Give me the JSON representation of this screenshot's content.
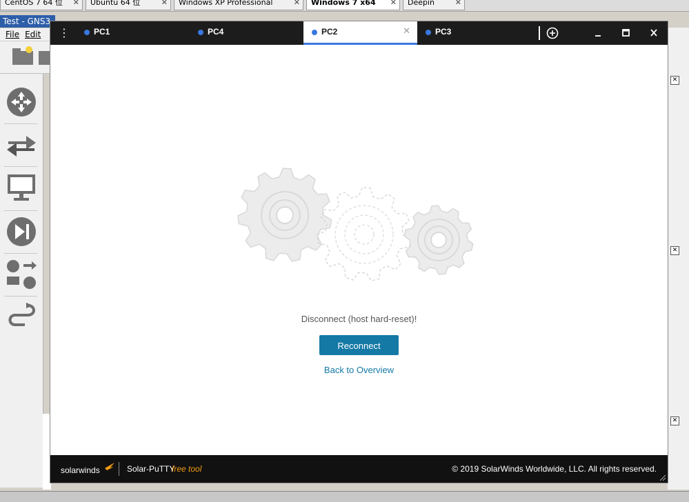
{
  "vm_tabs": [
    {
      "label": "CentOS 7 64 位",
      "active": false
    },
    {
      "label": "Ubuntu 64 位",
      "active": false
    },
    {
      "label": "Windows XP Professional",
      "active": false
    },
    {
      "label": "Windows 7 x64",
      "active": true
    },
    {
      "label": "Deepin",
      "active": false
    }
  ],
  "gns": {
    "title": "Test - GNS3",
    "menu": [
      "File",
      "Edit"
    ]
  },
  "putty": {
    "tabs": [
      {
        "label": "PC1",
        "active": false
      },
      {
        "label": "PC4",
        "active": false
      },
      {
        "label": "PC2",
        "active": true
      },
      {
        "label": "PC3",
        "active": false
      }
    ],
    "message": "Disconnect (host hard-reset)!",
    "reconnect_label": "Reconnect",
    "back_label": "Back to Overview",
    "footer": {
      "brand": "solarwinds",
      "product": "Solar-PuTTY",
      "free_tool": "free tool",
      "copyright": "© 2019 SolarWinds Worldwide, LLC. All rights reserved."
    }
  },
  "colors": {
    "accent": "#1479a5",
    "tab_dot": "#3a78e0",
    "tabbar_bg": "#1c1c1c",
    "footer_bg": "#111111",
    "free_tool": "#f39c12"
  }
}
